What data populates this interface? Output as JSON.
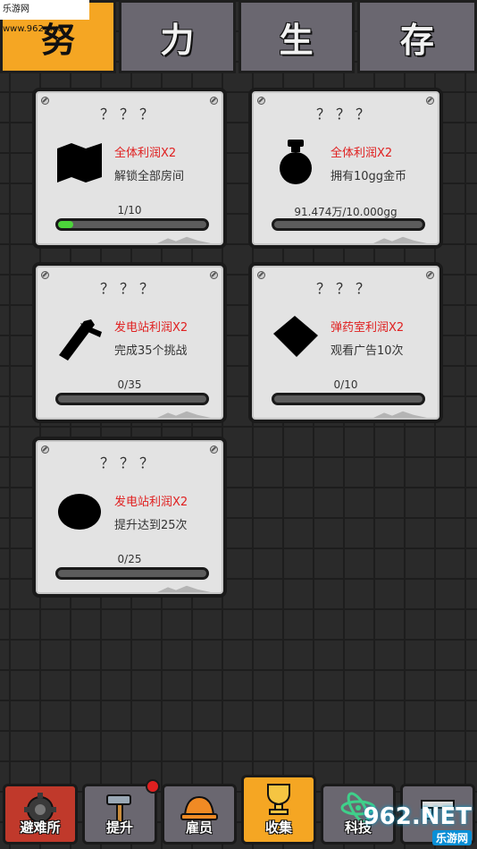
{
  "watermark_top": "乐游网 www.962.net",
  "tabs": [
    {
      "label": "努",
      "active": true
    },
    {
      "label": "力",
      "active": false
    },
    {
      "label": "生",
      "active": false
    },
    {
      "label": "存",
      "active": false
    }
  ],
  "cards": [
    {
      "title": "？？？",
      "icon": "map-silhouette-icon",
      "reward": "全体利润X2",
      "condition": "解锁全部房间",
      "progress_text": "1/10",
      "progress": 0.1
    },
    {
      "title": "？？？",
      "icon": "money-bag-silhouette-icon",
      "reward": "全体利润X2",
      "condition": "拥有10gg金币",
      "progress_text": "91.474万/10.000gg",
      "progress": 0.0
    },
    {
      "title": "？？？",
      "icon": "pliers-silhouette-icon",
      "reward": "发电站利润X2",
      "condition": "完成35个挑战",
      "progress_text": "0/35",
      "progress": 0.0
    },
    {
      "title": "？？？",
      "icon": "box-silhouette-icon",
      "reward": "弹药室利润X2",
      "condition": "观看广告10次",
      "progress_text": "0/10",
      "progress": 0.0
    },
    {
      "title": "？？？",
      "icon": "disc-silhouette-icon",
      "reward": "发电站利润X2",
      "condition": "提升达到25次",
      "progress_text": "0/25",
      "progress": 0.0
    }
  ],
  "nav": [
    {
      "label": "避难所",
      "icon": "gear-icon"
    },
    {
      "label": "提升",
      "icon": "hammer-icon"
    },
    {
      "label": "雇员",
      "icon": "hardhat-icon"
    },
    {
      "label": "收集",
      "icon": "trophy-icon"
    },
    {
      "label": "科技",
      "icon": "atom-icon"
    },
    {
      "label": "",
      "icon": "gun-icon"
    }
  ],
  "watermark_bottom": {
    "big": "962.NET",
    "small": "乐游网"
  }
}
